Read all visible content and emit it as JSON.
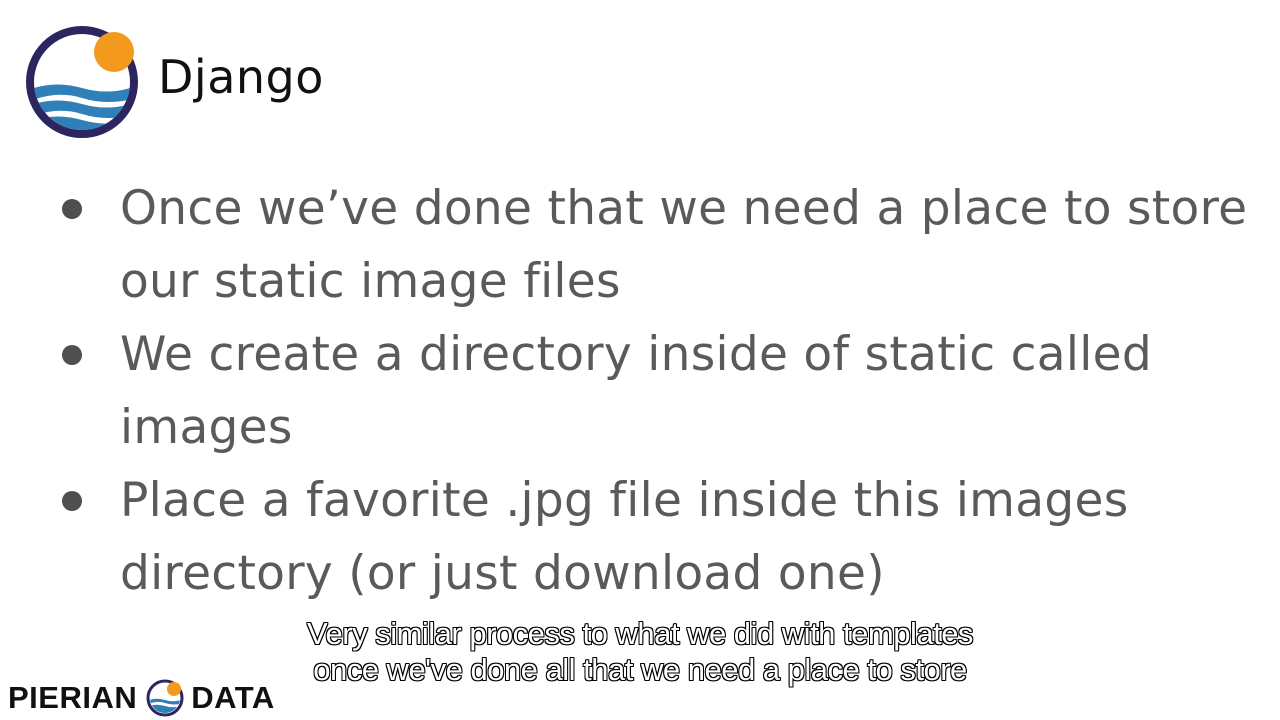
{
  "header": {
    "title": "Django",
    "logo_icon": "django-circle-logo-icon"
  },
  "bullets": [
    {
      "text": "Once we’ve done that we need a place to store our static image files"
    },
    {
      "text": "We create a directory inside of static called images"
    },
    {
      "text": "Place a favorite .jpg file inside this images directory (or just download one)"
    }
  ],
  "captions": {
    "line1": "Very similar process to what we did with templates",
    "line2": "once we've done all that we need a place to store"
  },
  "footer": {
    "left_text": "PIERIAN",
    "right_text": "DATA",
    "icon": "pierian-data-logo-icon"
  },
  "colors": {
    "logo_ring": "#2b2560",
    "logo_sun": "#f39a1e",
    "logo_waves": "#2f7fb8",
    "bullet_text": "#5a5a5a",
    "title_text": "#111111"
  }
}
